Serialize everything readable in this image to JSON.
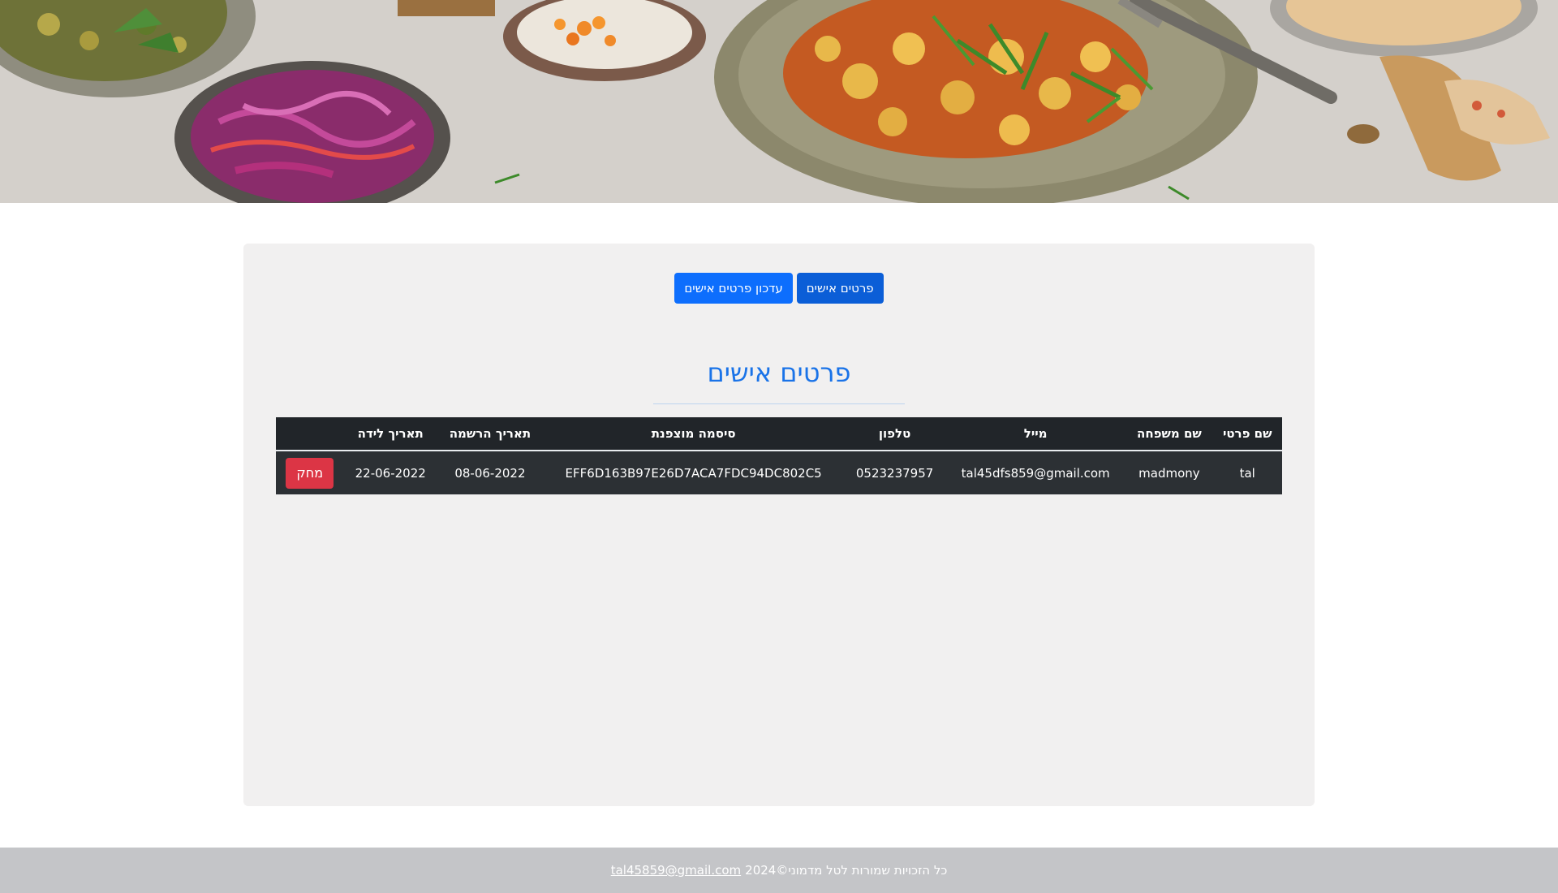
{
  "hero": {
    "alt": ""
  },
  "nav": {
    "buttons": [
      {
        "label": "פרטים אישים",
        "active": true
      },
      {
        "label": "עדכון פרטים אישים",
        "active": false
      }
    ]
  },
  "section": {
    "title": "פרטים אישים"
  },
  "table": {
    "headers": {
      "first_name": "שם פרטי",
      "last_name": "שם משפחה",
      "email": "מייל",
      "phone": "טלפון",
      "password": "סיסמה מוצפנת",
      "registration_date": "תאריך הרשמה",
      "birth_date": "תאריך לידה"
    },
    "rows": [
      {
        "first_name": "tal",
        "last_name": "madmony",
        "email": "tal45dfs859@gmail.com",
        "phone": "0523237957",
        "password": "EFF6D163B97E26D7ACA7FDC94DC802C5",
        "registration_date": "08-06-2022",
        "birth_date": "22-06-2022",
        "delete_label": "מחק"
      }
    ]
  },
  "footer": {
    "text": "כל הזכויות שמורות לטל מדמוני©2024",
    "email": "tal45859@gmail.com"
  },
  "colors": {
    "primary": "#0d6efd",
    "danger": "#dc3545",
    "title": "#1a73e8",
    "table_dark": "#212529",
    "footer": "#c4c5c8"
  }
}
